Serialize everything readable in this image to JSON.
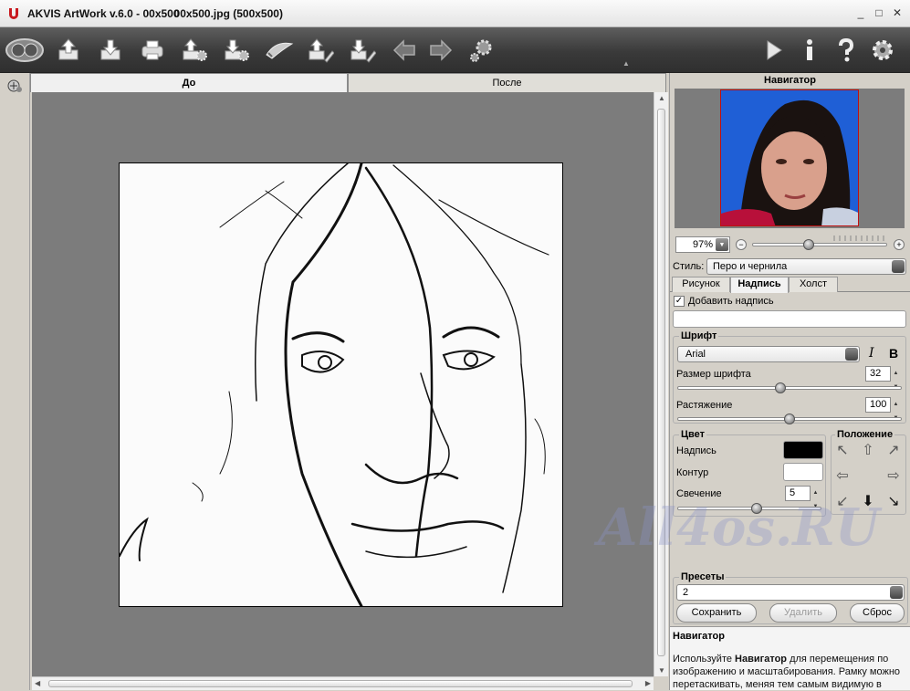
{
  "window": {
    "title": "AKVIS ArtWork v.6.0 - 00x500",
    "title_overlap": "00x500.jpg (500x500)",
    "controls": {
      "minimize": "_",
      "maximize": "□",
      "close": "✕"
    }
  },
  "toolbar": {
    "icons": [
      "camera-lens-icon",
      "open-upload-icon",
      "save-download-icon",
      "print-icon",
      "upload-settings-icon",
      "download-settings-icon",
      "brush-icon",
      "upload-pen-icon",
      "download-pen-icon",
      "back-arrow-icon",
      "forward-arrow-icon",
      "settings-small-icon"
    ],
    "right_icons": [
      "run-play-icon",
      "info-icon",
      "help-icon",
      "preferences-gear-icon"
    ]
  },
  "tabs": {
    "before": "До",
    "after": "После"
  },
  "navigator": {
    "title": "Навигатор",
    "zoom": "97%",
    "zoom_minus": "−",
    "zoom_plus": "+",
    "zoom_slider_fraction": 0.42
  },
  "style": {
    "label": "Стиль:",
    "value": "Перо и чернила"
  },
  "subtabs": {
    "drawing": "Рисунок",
    "inscription": "Надпись",
    "canvas": "Холст"
  },
  "inscription": {
    "add_label": "Добавить надпись",
    "checked": "✓",
    "text_value": "",
    "font": {
      "group_label": "Шрифт",
      "family": "Arial",
      "italic": "I",
      "bold": "B",
      "size_label": "Размер шрифта",
      "size_value": "32",
      "size_slider_fraction": 0.46,
      "stretch_label": "Растяжение",
      "stretch_value": "100",
      "stretch_slider_fraction": 0.5
    },
    "color": {
      "group_label": "Цвет",
      "inscription_label": "Надпись",
      "inscription_color": "#000000",
      "outline_label": "Контур",
      "outline_color": "#ffffff",
      "glow_label": "Свечение",
      "glow_value": "5",
      "glow_slider_fraction": 0.55
    },
    "position": {
      "group_label": "Положение",
      "arrows": [
        "↖",
        "⇧",
        "↗",
        "⇦",
        "⇨",
        "↙",
        "⬇",
        "↘"
      ]
    }
  },
  "presets": {
    "label": "Пресеты",
    "value": "2",
    "save": "Сохранить",
    "delete": "Удалить",
    "reset": "Сброс"
  },
  "help": {
    "title": "Навигатор",
    "body_pre": "Используйте ",
    "body_bold": "Навигатор",
    "body_post": " для перемещения по изображению и масштабирования. Рамку можно перетаскивать, меняя тем самым видимую в"
  },
  "watermark": "All4os.RU"
}
